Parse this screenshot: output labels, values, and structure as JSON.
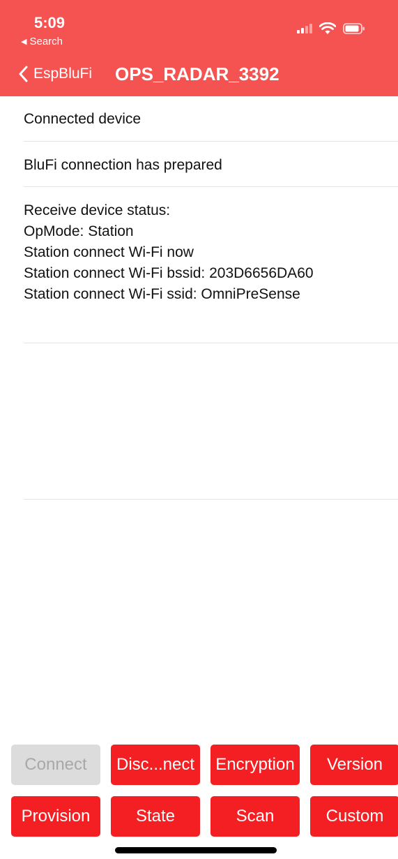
{
  "status_bar": {
    "time": "5:09",
    "back_app": "Search",
    "signal_icon": "cellular-signal-icon",
    "wifi_icon": "wifi-icon",
    "battery_icon": "battery-icon"
  },
  "nav": {
    "back_label": "EspBluFi",
    "title": "OPS_RADAR_3392"
  },
  "log": [
    {
      "lines": [
        "Connected device"
      ]
    },
    {
      "lines": [
        "BluFi connection has prepared"
      ]
    },
    {
      "lines": [
        "Receive device status:",
        "OpMode: Station",
        "Station connect Wi-Fi now",
        "Station connect Wi-Fi bssid: 203D6656DA60",
        "Station connect Wi-Fi ssid: OmniPreSense"
      ]
    }
  ],
  "buttons": {
    "connect": "Connect",
    "disconnect": "Disc...nect",
    "encryption": "Encryption",
    "version": "Version",
    "provision": "Provision",
    "state": "State",
    "scan": "Scan",
    "custom": "Custom"
  },
  "colors": {
    "header": "#f55252",
    "button": "#f31f22",
    "button_disabled": "#dcdcdc"
  }
}
